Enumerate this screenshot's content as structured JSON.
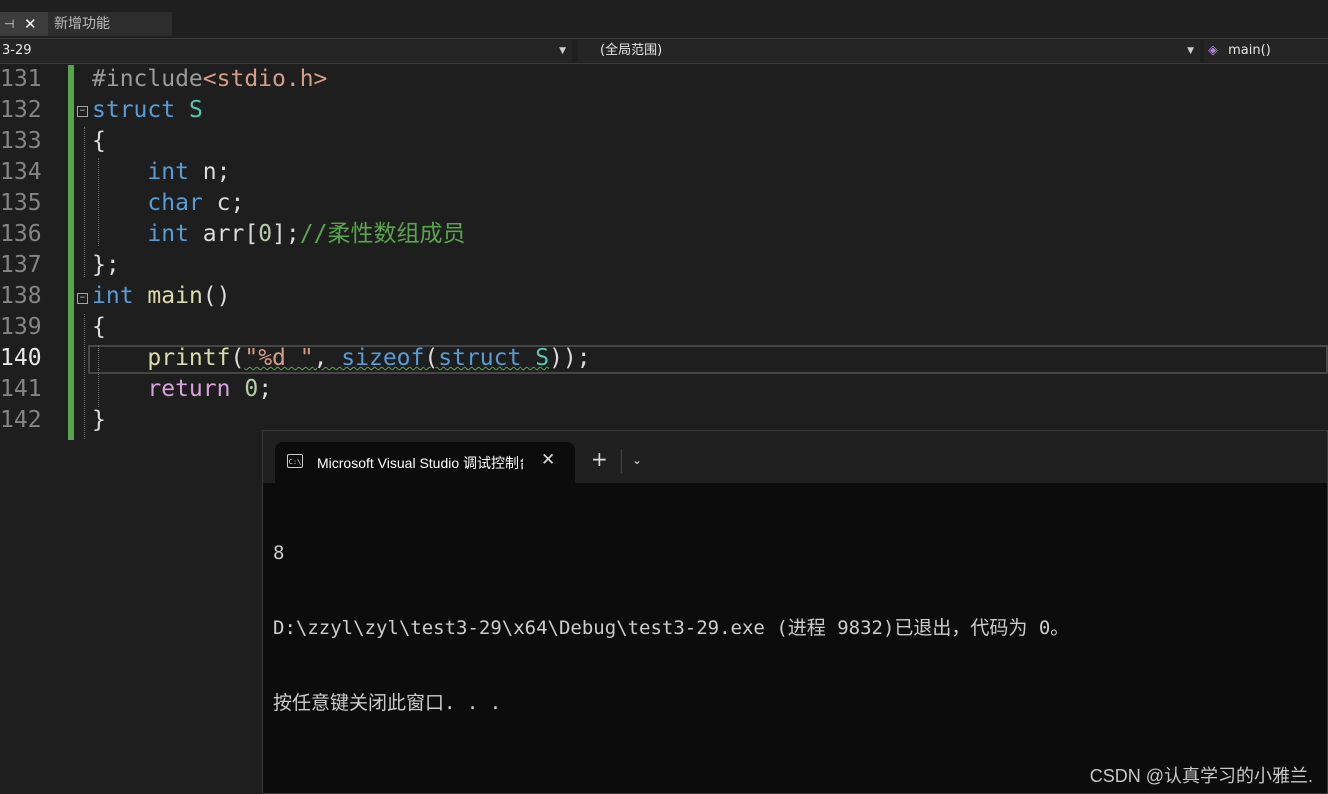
{
  "tabs": {
    "active_pin": "⊣",
    "active_close": "✕",
    "inactive_label": "新增功能"
  },
  "navbar": {
    "project": "3-29",
    "scope": "(全局范围)",
    "member": "main()"
  },
  "editor": {
    "current_line": "140",
    "lines": [
      {
        "number": "131",
        "tokens": [
          [
            "pp",
            "#include"
          ],
          [
            "str",
            "<stdio.h>"
          ]
        ]
      },
      {
        "number": "132",
        "tokens": [
          [
            "kw",
            "struct"
          ],
          [
            "plain",
            " "
          ],
          [
            "ty",
            "S"
          ]
        ]
      },
      {
        "number": "133",
        "tokens": [
          [
            "plain",
            "{"
          ]
        ]
      },
      {
        "number": "134",
        "tokens": [
          [
            "plain",
            "    "
          ],
          [
            "kw",
            "int"
          ],
          [
            "plain",
            " n;"
          ]
        ]
      },
      {
        "number": "135",
        "tokens": [
          [
            "plain",
            "    "
          ],
          [
            "kw",
            "char"
          ],
          [
            "plain",
            " c;"
          ]
        ]
      },
      {
        "number": "136",
        "tokens": [
          [
            "plain",
            "    "
          ],
          [
            "kw",
            "int"
          ],
          [
            "plain",
            " arr["
          ],
          [
            "num",
            "0"
          ],
          [
            "plain",
            "];"
          ],
          [
            "cmt",
            "//柔性数组成员"
          ]
        ]
      },
      {
        "number": "137",
        "tokens": [
          [
            "plain",
            "};"
          ]
        ]
      },
      {
        "number": "138",
        "tokens": [
          [
            "kw",
            "int"
          ],
          [
            "plain",
            " "
          ],
          [
            "fn",
            "main"
          ],
          [
            "plain",
            "()"
          ]
        ]
      },
      {
        "number": "139",
        "tokens": [
          [
            "plain",
            "{"
          ]
        ]
      },
      {
        "number": "140",
        "tokens": [
          [
            "plain",
            "    "
          ],
          [
            "fn",
            "printf"
          ],
          [
            "plain",
            "("
          ],
          [
            "str",
            "\"%d \""
          ],
          [
            "plain",
            ", "
          ],
          [
            "kw",
            "sizeof"
          ],
          [
            "plain",
            "("
          ],
          [
            "kw",
            "struct"
          ],
          [
            "plain",
            " "
          ],
          [
            "ty",
            "S"
          ],
          [
            "plain",
            "));"
          ]
        ]
      },
      {
        "number": "141",
        "tokens": [
          [
            "plain",
            "    "
          ],
          [
            "ctl",
            "return"
          ],
          [
            "plain",
            " "
          ],
          [
            "num",
            "0"
          ],
          [
            "plain",
            ";"
          ]
        ]
      },
      {
        "number": "142",
        "tokens": [
          [
            "plain",
            "}"
          ]
        ]
      }
    ]
  },
  "console": {
    "tab_title": "Microsoft Visual Studio 调试控制台",
    "tab_icon_text": "C:\\",
    "close_glyph": "✕",
    "new_tab_glyph": "+",
    "dropdown_glyph": "⌄",
    "output": [
      "8",
      "D:\\zzyl\\zyl\\test3-29\\x64\\Debug\\test3-29.exe (进程 9832)已退出，代码为 0。",
      "按任意键关闭此窗口. . ."
    ]
  },
  "watermark": "CSDN @认真学习的小雅兰.",
  "colors": {
    "keyword": "#569cd6",
    "type": "#4ec9b0",
    "function": "#dcdcaa",
    "string": "#d69d85",
    "number": "#b5cea8",
    "comment": "#57a64a",
    "control": "#d8a0df",
    "change_bar": "#57a64a"
  }
}
